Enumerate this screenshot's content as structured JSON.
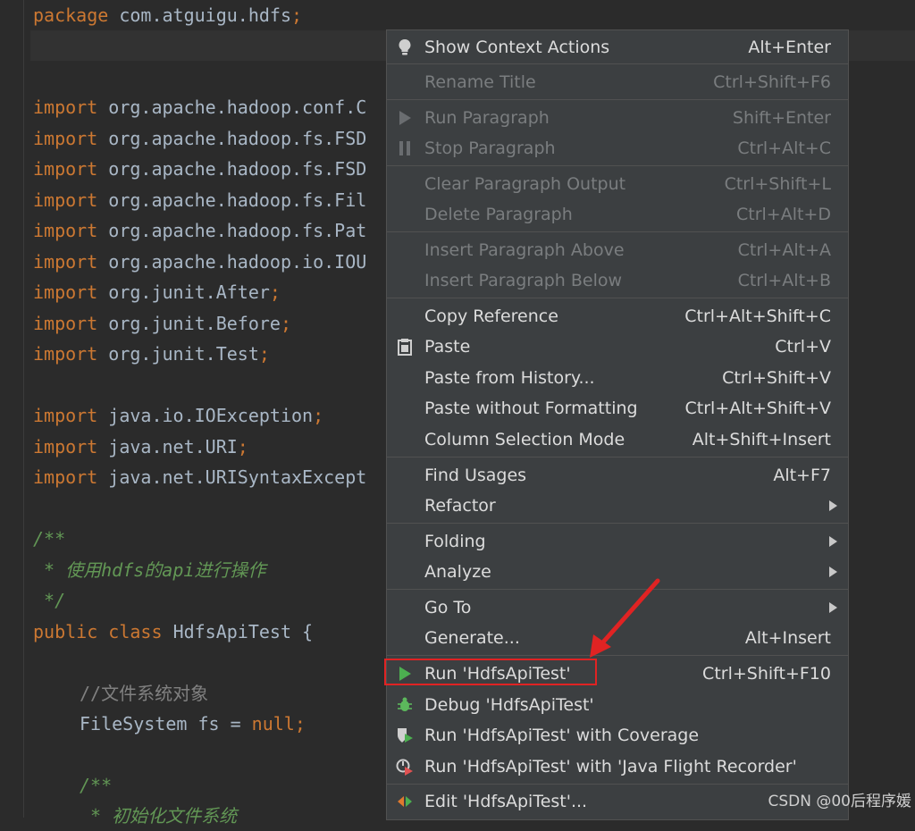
{
  "editor": {
    "package_kw": "package",
    "package_name": "com.atguigu.hdfs",
    "semicolon": ";",
    "import_kw": "import",
    "imports1": [
      "org.apache.hadoop.conf.C",
      "org.apache.hadoop.fs.FSD",
      "org.apache.hadoop.fs.FSD",
      "org.apache.hadoop.fs.Fil",
      "org.apache.hadoop.fs.Pat",
      "org.apache.hadoop.io.IOU"
    ],
    "imports2": [
      "org.junit.After",
      "org.junit.Before",
      "org.junit.Test"
    ],
    "imports3": [
      "java.io.IOException",
      "java.net.URI",
      "java.net.URISyntaxExcept"
    ],
    "doc_open": "/**",
    "doc_line": " * 使用hdfs的api进行操作",
    "doc_close": " */",
    "public_kw": "public",
    "class_kw": "class",
    "class_name": "HdfsApiTest {",
    "field_comment": "//文件系统对象",
    "field_type": "FileSystem fs = ",
    "null_kw": "null",
    "doc2_open": "/**",
    "doc2_line": " * 初始化文件系统"
  },
  "menu": {
    "items": [
      {
        "label": "Show Context Actions",
        "shortcut": "Alt+Enter",
        "icon": "bulb-icon",
        "disabled": false
      },
      {
        "label": "Rename Title",
        "shortcut": "Ctrl+Shift+F6",
        "disabled": true
      },
      {
        "label": "Run Paragraph",
        "shortcut": "Shift+Enter",
        "icon": "run-paragraph-icon",
        "disabled": true
      },
      {
        "label": "Stop Paragraph",
        "shortcut": "Ctrl+Alt+C",
        "icon": "pause-icon",
        "disabled": true
      },
      {
        "label": "Clear Paragraph Output",
        "shortcut": "Ctrl+Shift+L",
        "disabled": true
      },
      {
        "label": "Delete Paragraph",
        "shortcut": "Ctrl+Alt+D",
        "disabled": true
      },
      {
        "label": "Insert Paragraph Above",
        "shortcut": "Ctrl+Alt+A",
        "disabled": true
      },
      {
        "label": "Insert Paragraph Below",
        "shortcut": "Ctrl+Alt+B",
        "disabled": true
      },
      {
        "label": "Copy Reference",
        "shortcut": "Ctrl+Alt+Shift+C",
        "disabled": false
      },
      {
        "label": "Paste",
        "shortcut": "Ctrl+V",
        "icon": "clipboard-icon",
        "disabled": false
      },
      {
        "label": "Paste from History...",
        "shortcut": "Ctrl+Shift+V",
        "disabled": false
      },
      {
        "label": "Paste without Formatting",
        "shortcut": "Ctrl+Alt+Shift+V",
        "disabled": false
      },
      {
        "label": "Column Selection Mode",
        "shortcut": "Alt+Shift+Insert",
        "disabled": false
      },
      {
        "label": "Find Usages",
        "shortcut": "Alt+F7",
        "disabled": false
      },
      {
        "label": "Refactor",
        "shortcut": "",
        "submenu": true,
        "disabled": false
      },
      {
        "label": "Folding",
        "shortcut": "",
        "submenu": true,
        "disabled": false
      },
      {
        "label": "Analyze",
        "shortcut": "",
        "submenu": true,
        "disabled": false
      },
      {
        "label": "Go To",
        "shortcut": "",
        "submenu": true,
        "disabled": false
      },
      {
        "label": "Generate...",
        "shortcut": "Alt+Insert",
        "disabled": false
      },
      {
        "label": "Run 'HdfsApiTest'",
        "shortcut": "Ctrl+Shift+F10",
        "icon": "run-icon",
        "disabled": false
      },
      {
        "label": "Debug 'HdfsApiTest'",
        "shortcut": "",
        "icon": "debug-icon",
        "disabled": false
      },
      {
        "label": "Run 'HdfsApiTest' with Coverage",
        "shortcut": "",
        "icon": "coverage-icon",
        "disabled": false
      },
      {
        "label": "Run 'HdfsApiTest' with 'Java Flight Recorder'",
        "shortcut": "",
        "icon": "profiler-icon",
        "disabled": false
      },
      {
        "label": "Edit 'HdfsApiTest'...",
        "shortcut": "",
        "icon": "edit-config-icon",
        "disabled": false
      }
    ]
  },
  "annotation": {
    "colors": {
      "highlight": "#e02323"
    }
  },
  "watermark": "CSDN @00后程序媛"
}
